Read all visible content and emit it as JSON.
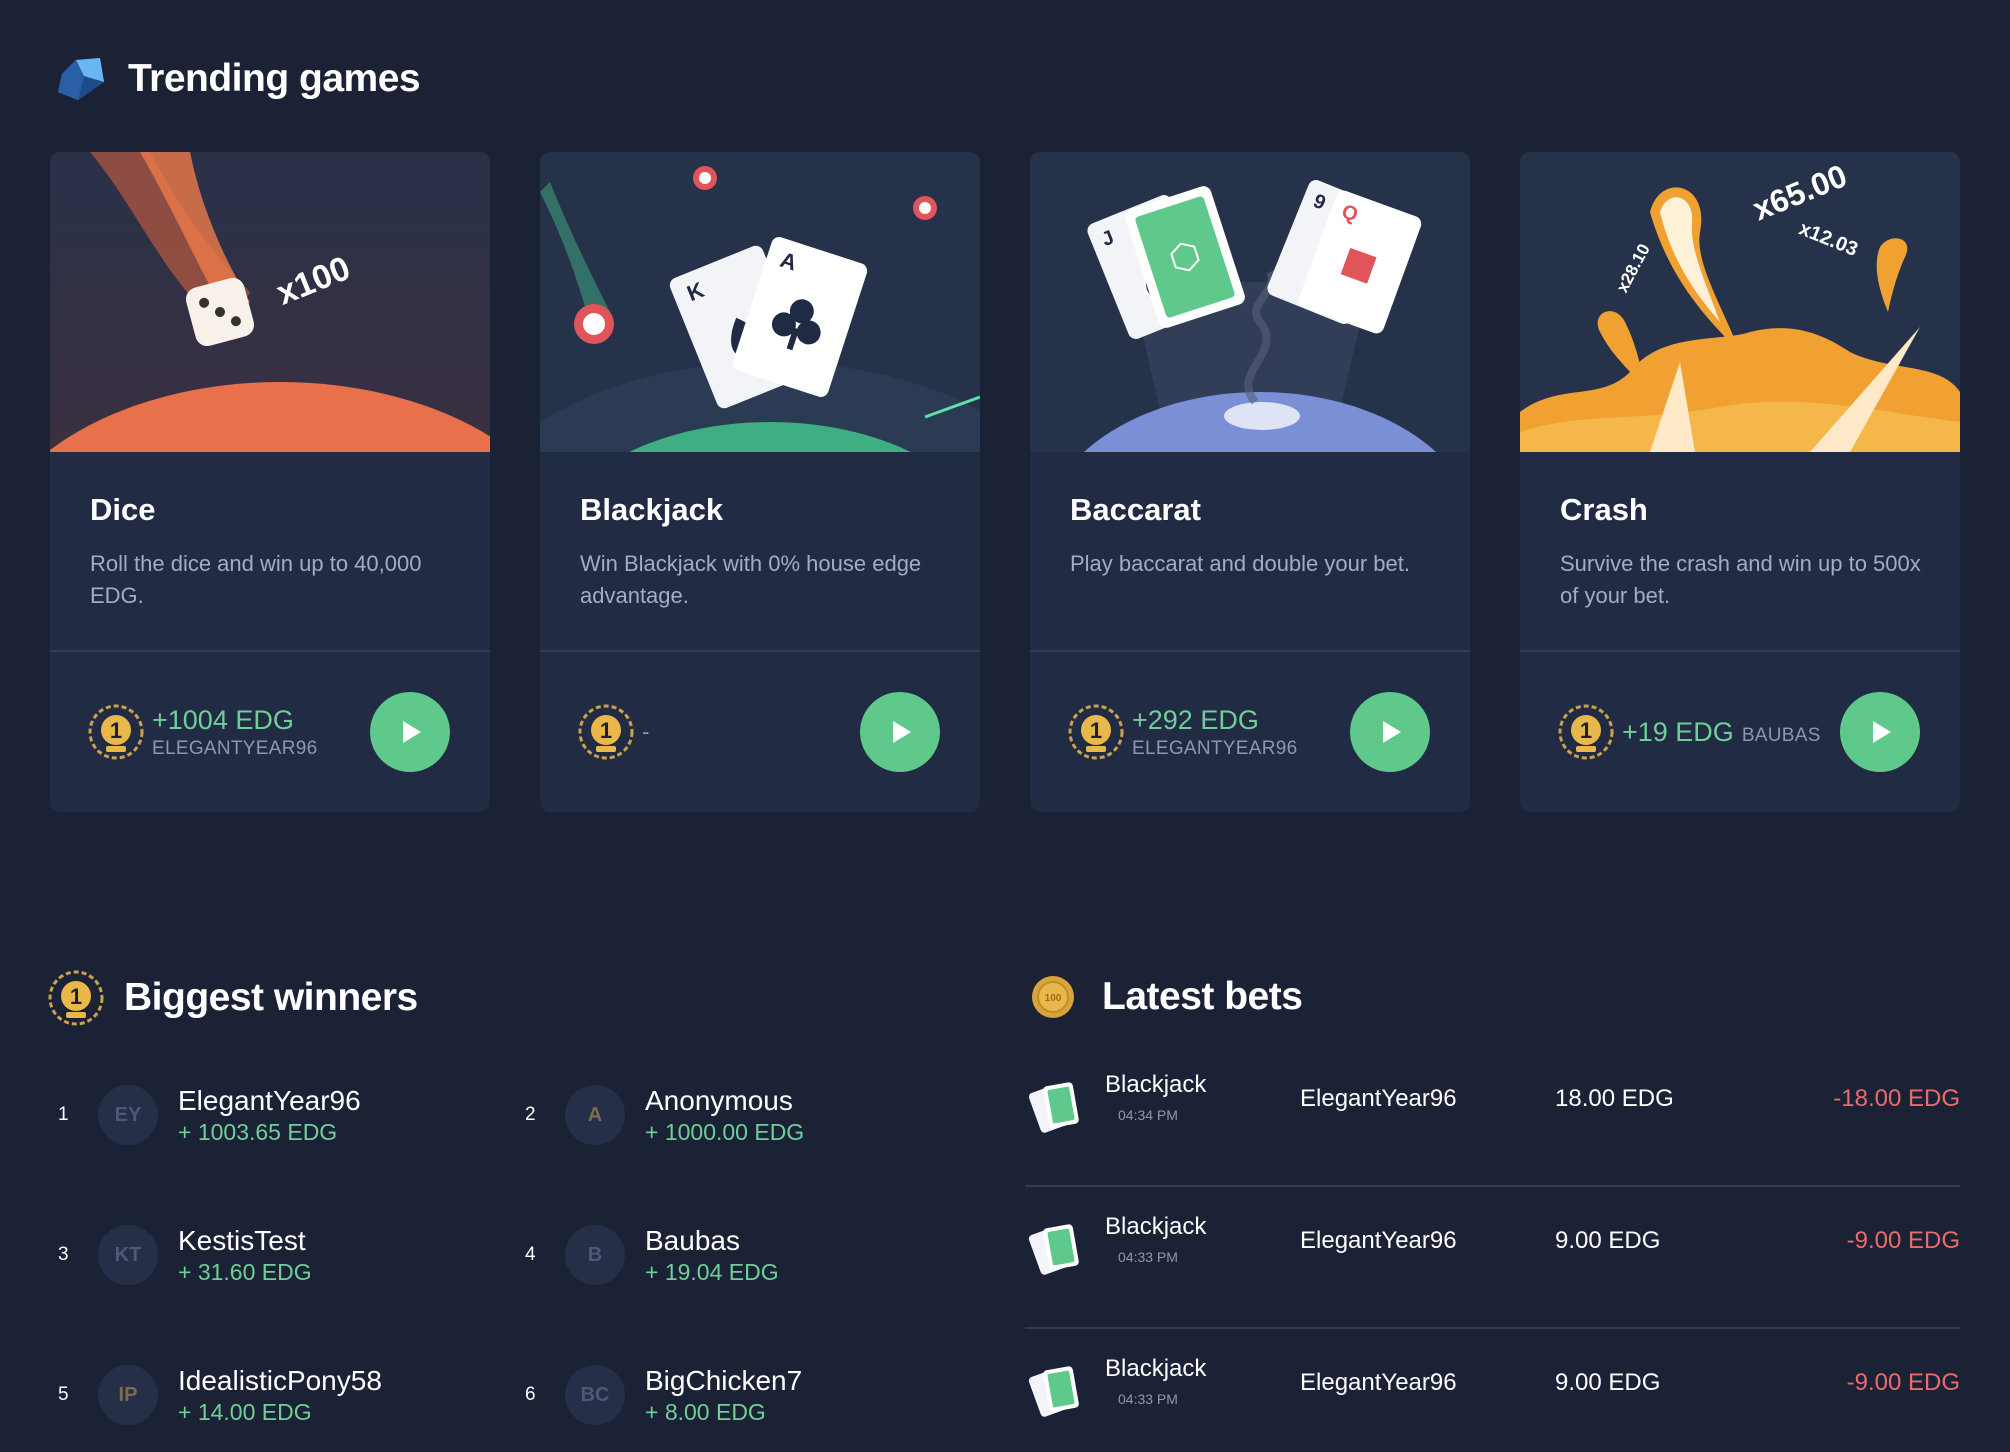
{
  "trending": {
    "title": "Trending games",
    "games": [
      {
        "name": "Dice",
        "description": "Roll the dice and win up to 40,000 EDG.",
        "art_text": "x100",
        "winner_amount": "+1004 EDG",
        "winner_user": "ELEGANTYEAR96"
      },
      {
        "name": "Blackjack",
        "description": "Win Blackjack with 0% house edge advantage.",
        "winner_amount": "-"
      },
      {
        "name": "Baccarat",
        "description": "Play baccarat and double your bet.",
        "winner_amount": "+292 EDG",
        "winner_user": "ELEGANTYEAR96"
      },
      {
        "name": "Crash",
        "description": "Survive the crash and win up to 500x of your bet.",
        "art_texts": [
          "x65.00",
          "x12.03",
          "x28.10"
        ],
        "winner_amount": "+19 EDG",
        "winner_user": "BAUBAS"
      }
    ]
  },
  "winners": {
    "title": "Biggest winners",
    "list": [
      {
        "rank": "1",
        "initials": "EY",
        "name": "ElegantYear96",
        "amount": "+ 1003.65 EDG"
      },
      {
        "rank": "2",
        "initials": "A",
        "name": "Anonymous",
        "amount": "+ 1000.00 EDG"
      },
      {
        "rank": "3",
        "initials": "KT",
        "name": "KestisTest",
        "amount": "+ 31.60 EDG"
      },
      {
        "rank": "4",
        "initials": "B",
        "name": "Baubas",
        "amount": "+ 19.04 EDG"
      },
      {
        "rank": "5",
        "initials": "IP",
        "name": "IdealisticPony58",
        "amount": "+ 14.00 EDG"
      },
      {
        "rank": "6",
        "initials": "BC",
        "name": "BigChicken7",
        "amount": "+ 8.00 EDG"
      }
    ]
  },
  "bets": {
    "title": "Latest bets",
    "coin_text": "100",
    "rows": [
      {
        "game": "Blackjack",
        "time": "04:34 PM",
        "user": "ElegantYear96",
        "amount": "18.00 EDG",
        "profit": "-18.00 EDG"
      },
      {
        "game": "Blackjack",
        "time": "04:33 PM",
        "user": "ElegantYear96",
        "amount": "9.00 EDG",
        "profit": "-9.00 EDG"
      },
      {
        "game": "Blackjack",
        "time": "04:33 PM",
        "user": "ElegantYear96",
        "amount": "9.00 EDG",
        "profit": "-9.00 EDG"
      }
    ]
  },
  "colors": {
    "background": "#1b2236",
    "card": "#222b44",
    "accent_green": "#5ec98a",
    "positive": "#6fcf97",
    "negative": "#eb6a6a",
    "muted": "#a3acc2"
  },
  "icons": {
    "trending": "diamond-icon",
    "winners": "laurel-medal-icon",
    "bets": "coin-icon",
    "play": "play-icon",
    "bet_game": "cards-icon"
  }
}
